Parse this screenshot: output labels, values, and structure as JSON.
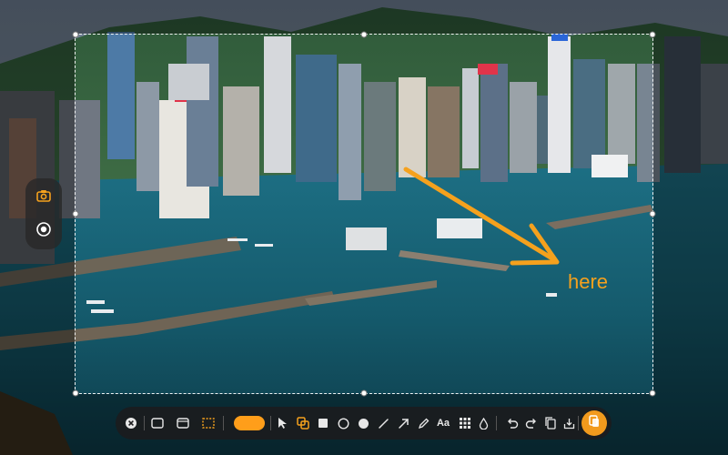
{
  "annotation": {
    "text": "here",
    "color": "#f5a11d"
  },
  "colors": {
    "accent": "#f5a11d",
    "capture": "#f29a1d",
    "toolbar_bg": "#1c1c1e",
    "side_toolbar_bg": "#282828",
    "camera_icon": "#f5a11d",
    "record_icon": "#ffffff"
  },
  "side_toolbar": {
    "items": [
      {
        "icon": "camera-icon",
        "active": true
      },
      {
        "icon": "record-icon",
        "active": false
      }
    ]
  },
  "toolbar": {
    "text_tool_label": "Aa",
    "selected_color": "#ff9e1a",
    "tools": [
      "close-icon",
      "rectangle-mode-icon",
      "window-mode-icon",
      "custom-area-icon",
      "color-swatch",
      "pointer-icon",
      "copy-layer-icon",
      "filled-square-icon",
      "circle-outline-icon",
      "filled-circle-icon",
      "line-icon",
      "arrow-icon",
      "pen-icon",
      "text-icon",
      "mosaic-icon",
      "blur-drop-icon",
      "undo-icon",
      "redo-icon",
      "copy-icon",
      "save-icon",
      "capture-icon"
    ]
  }
}
